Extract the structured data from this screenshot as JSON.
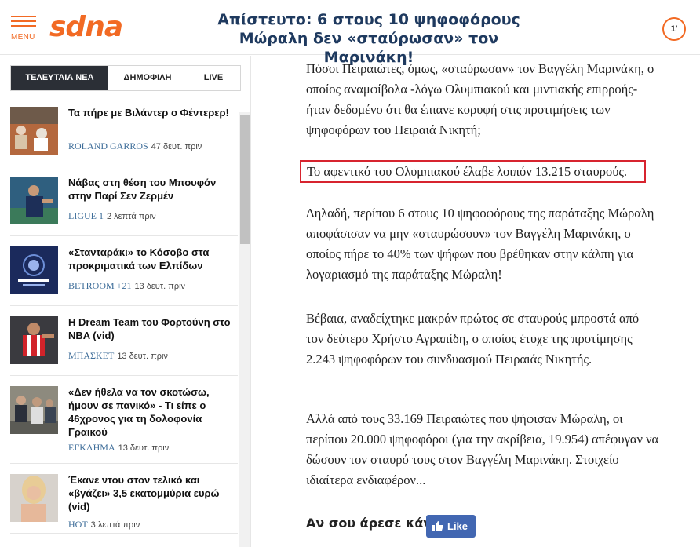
{
  "header": {
    "menu_label": "MENU",
    "logo": "SDNA",
    "headline": "Απίστευτο: 6 στους 10 ψηφοφόρους Μώραλη δεν «σταύρωσαν» τον Μαρινάκη!",
    "clock": "1'"
  },
  "sidebar": {
    "tabs": [
      "ΤΕΛΕΥΤΑΙΑ ΝΕΑ",
      "ΔΗΜΟΦΙΛΗ",
      "LIVE"
    ],
    "items": [
      {
        "title": "Τα πήρε με Βιλάντερ ο Φέντερερ!",
        "category": "ROLAND GARROS",
        "time": "47 δευτ. πριν"
      },
      {
        "title": "Νάβας στη θέση του Μπουφόν στην Παρί Σεν Ζερμέν",
        "category": "LIGUE 1",
        "time": "2 λεπτά πριν"
      },
      {
        "title": "«Στανταράκι» το Κόσοβο στα προκριματικά των Ελπίδων",
        "category": "BETROOM +21",
        "time": "13 δευτ. πριν"
      },
      {
        "title": "Η Dream Team του Φορτούνη στο NBA (vid)",
        "category": "ΜΠΑΣΚΕΤ",
        "time": "13 δευτ. πριν"
      },
      {
        "title": "«Δεν ήθελα να τον σκοτώσω, ήμουν σε πανικό» - Τι είπε ο 46χρονος για τη δολοφονία Γραικού",
        "category": "ΕΓΚΛΗΜΑ",
        "time": "13 δευτ. πριν"
      },
      {
        "title": "Έκανε ντου στον τελικό και «βγάζει» 3,5 εκατομμύρια ευρώ (vid)",
        "category": "HOT",
        "time": "3 λεπτά πριν"
      }
    ]
  },
  "article": {
    "paragraphs": [
      "Πόσοι Πειραιώτες, όμως, «σταύρωσαν» τον Βαγγέλη Μαρινάκη, ο οποίος αναμφίβολα -λόγω Ολυμπιακού και μιντιακής επιρροής- ήταν δεδομένο ότι θα έπιανε κορυφή στις προτιμήσεις των ψηφοφόρων του Πειραιά Νικητή;",
      "Το αφεντικό του Ολυμπιακού έλαβε λοιπόν 13.215 σταυρούς.",
      "Δηλαδή, περίπου 6 στους 10 ψηφοφόρους της παράταξης Μώραλη αποφάσισαν να μην «σταυρώσουν» τον Βαγγέλη Μαρινάκη, ο οποίος πήρε το 40% των ψήφων που βρέθηκαν στην κάλπη για λογαριασμό της παράταξης Μώραλη!",
      "Βέβαια, αναδείχτηκε μακράν πρώτος σε σταυρούς μπροστά από τον δεύτερο Χρήστο Αγραπίδη, ο οποίος έτυχε της προτίμησης 2.243 ψηφοφόρων του συνδυασμού Πειραιάς Νικητής.",
      "Αλλά από τους 33.169 Πειραιώτες που ψήφισαν Μώραλη, οι περίπου 20.000 ψηφοφόροι (για την ακρίβεια, 19.954) απέφυγαν να δώσουν τον σταυρό τους στον Βαγγέλη Μαρινάκη. Στοιχείο ιδιαίτερα ενδιαφέρον..."
    ],
    "like_prompt": "Αν σου άρεσε κάνε",
    "like_button": "Like"
  },
  "colors": {
    "brand": "#f26a24",
    "headline": "#1f3a5f",
    "highlight_border": "#d7242f",
    "facebook": "#4267b2",
    "category": "#3f6e9a"
  }
}
